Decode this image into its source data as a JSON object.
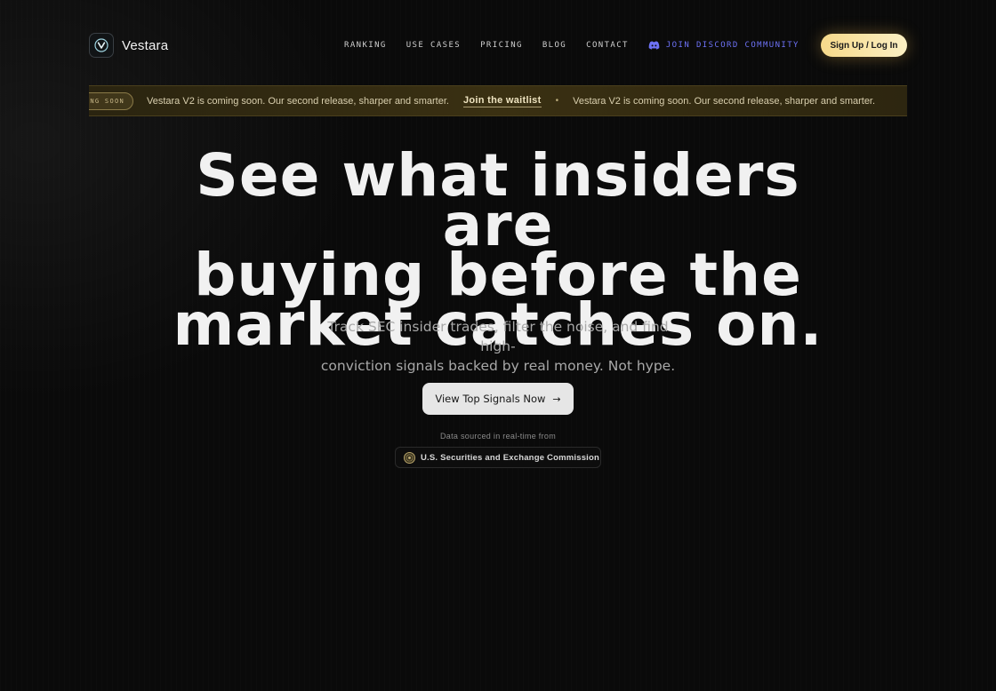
{
  "brand": {
    "name": "Vestara",
    "logo_icon": "v-logo-icon"
  },
  "nav": {
    "links": [
      {
        "label": "RANKING"
      },
      {
        "label": "USE CASES"
      },
      {
        "label": "PRICING"
      },
      {
        "label": "BLOG"
      },
      {
        "label": "CONTACT"
      }
    ],
    "discord": {
      "label": "JOIN DISCORD COMMUNITY",
      "icon": "discord-icon",
      "color": "#6d72f6"
    },
    "signup_label": "Sign Up / Log In"
  },
  "announcement": {
    "pill": "NG SOON",
    "message": "Vestara V2 is coming soon. Our second release, sharper and smarter.",
    "link": "Join the waitlist",
    "separator": "•",
    "message_repeat": "Vestara V2 is coming soon. Our second release, sharper and smarter."
  },
  "hero": {
    "title_line1": "See what insiders are",
    "title_line2": "buying before the",
    "title_line3": "market catches on.",
    "subtitle_line1": "Track SEC insider trades, filter the noise, and find high-",
    "subtitle_line2": "conviction signals backed by real money. Not hype.",
    "cta_label": "View Top Signals Now",
    "cta_arrow": "→"
  },
  "source": {
    "label": "Data sourced in real-time from",
    "badge": "U.S. Securities and Exchange Commission",
    "badge_icon": "sec-seal-icon"
  },
  "colors": {
    "background": "#0a0a0a",
    "accent_gold": "#f6d98a",
    "discord": "#6d72f6"
  }
}
